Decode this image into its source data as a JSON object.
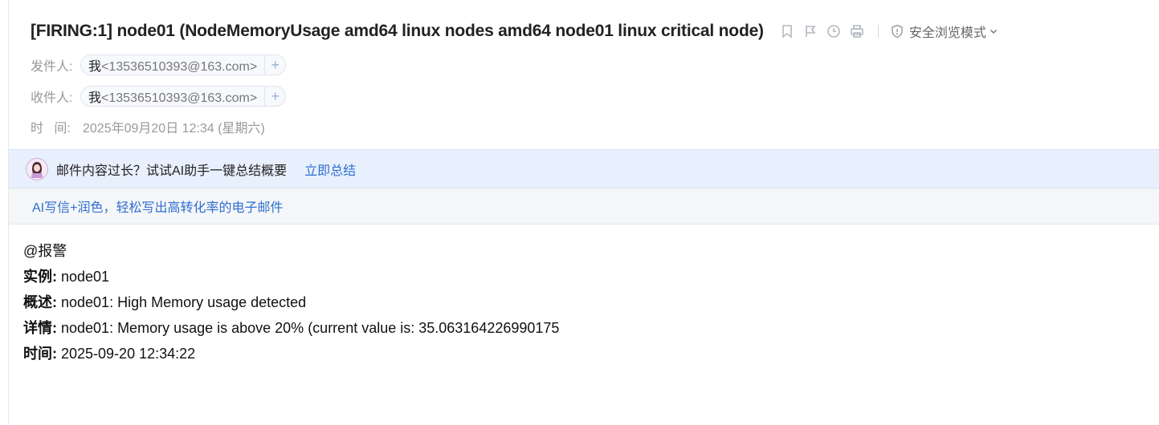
{
  "mail": {
    "subject": "[FIRING:1] node01 (NodeMemoryUsage amd64 linux nodes amd64 node01 linux critical node)",
    "tools": {
      "icons": [
        "bookmark-icon",
        "flag-icon",
        "clock-icon",
        "print-icon"
      ],
      "safe_mode_label": "安全浏览模式"
    },
    "from": {
      "label": "发件人:",
      "me": "我",
      "address": "<13536510393@163.com>",
      "add": "+"
    },
    "to": {
      "label": "收件人:",
      "me": "我",
      "address": "<13536510393@163.com>",
      "add": "+"
    },
    "time": {
      "label": "时   间:",
      "value": "2025年09月20日 12:34 (星期六)"
    }
  },
  "ai_banner": {
    "text": "邮件内容过长？试试AI助手一键总结概要",
    "link": "立即总结"
  },
  "promo": {
    "link": "AI写信+润色，轻松写出高转化率的电子邮件"
  },
  "body": {
    "mention": "@报警",
    "instance": {
      "label": "实例:",
      "value": " node01"
    },
    "summary": {
      "label": "概述:",
      "value": " node01: High Memory usage detected"
    },
    "details": {
      "label": "详情:",
      "value": " node01: Memory usage is above 20% (current value is: 35.063164226990175"
    },
    "time": {
      "label": "时间:",
      "value": " 2025-09-20 12:34:22"
    }
  },
  "colors": {
    "link": "#2f6fd1",
    "ai_banner_bg": "#e8f0fd",
    "promo_bg": "#f5f6f8"
  }
}
